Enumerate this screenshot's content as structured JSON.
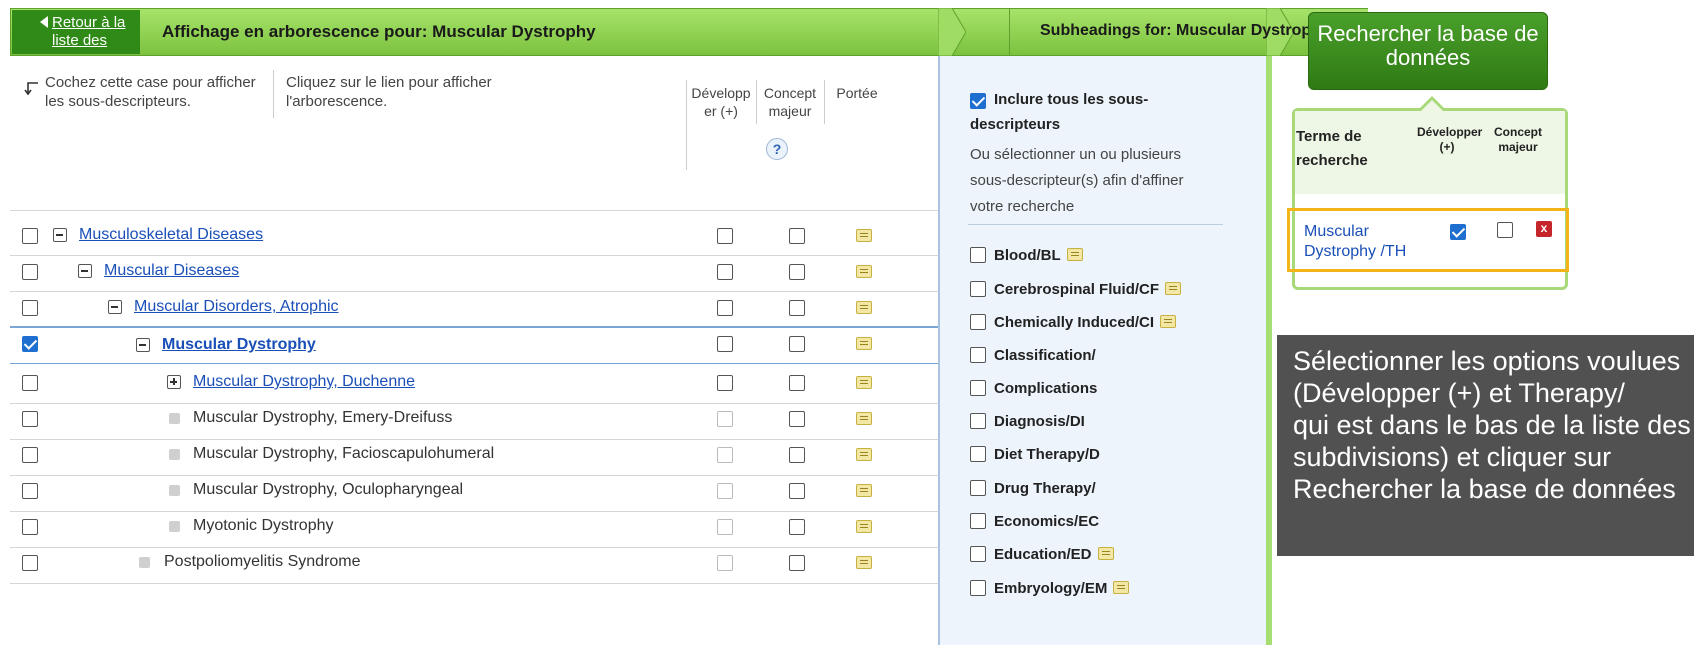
{
  "header": {
    "back_label": "Retour à la liste des",
    "tree_title": "Affichage en arborescence pour: Muscular Dystrophy",
    "subheadings_title": "Subheadings for: Muscular Dystrophy"
  },
  "tree": {
    "note_checkbox": "Cochez cette case pour afficher les sous-descripteurs.",
    "note_link": "Cliquez sur le lien pour afficher l'arborescence.",
    "col_explode": "Développ er (+)",
    "col_major": "Concept majeur",
    "col_scope": "Portée",
    "help_label": "?",
    "rows": [
      {
        "label": "Musculoskeletal Diseases",
        "link": true
      },
      {
        "label": "Muscular Diseases",
        "link": true
      },
      {
        "label": "Muscular Disorders, Atrophic",
        "link": true
      },
      {
        "label": "Muscular Dystrophy",
        "link": true,
        "selected": true
      },
      {
        "label": "Muscular Dystrophy, Duchenne",
        "link": true
      },
      {
        "label": "Muscular Dystrophy, Emery-Dreifuss",
        "link": false
      },
      {
        "label": "Muscular Dystrophy, Facioscapulohumeral",
        "link": false
      },
      {
        "label": "Muscular Dystrophy, Oculopharyngeal",
        "link": false
      },
      {
        "label": "Myotonic Dystrophy",
        "link": false
      },
      {
        "label": "Postpoliomyelitis Syndrome",
        "link": false
      }
    ]
  },
  "subheadings": {
    "include_all_label": "Inclure tous les sous-descripteurs",
    "include_all_line1": "Inclure tous les sous-",
    "include_all_line2": "descripteurs",
    "hint_line1": "Ou sélectionner un ou plusieurs",
    "hint_line2": "sous-descripteur(s) afin d'affiner",
    "hint_line3": "votre recherche",
    "items": [
      "Blood/BL",
      "Cerebrospinal Fluid/CF",
      "Chemically Induced/CI",
      "Classification/",
      "Complications",
      "Diagnosis/DI",
      "Diet Therapy/D",
      "Drug Therapy/",
      "Economics/EC",
      "Education/ED",
      "Embryology/EM"
    ]
  },
  "search": {
    "button_label": "Rechercher la base de données",
    "col_term": "Terme de recherche",
    "col_explode": "Développer (+)",
    "col_major": "Concept majeur",
    "term_line1": "Muscular",
    "term_line2": "Dystrophy /TH",
    "delete_label": "x"
  },
  "overlay": {
    "line1": "Sélectionner les options voulues",
    "line2": "(Développer (+) et Therapy/",
    "line3": "qui est dans le bas de la liste des",
    "line4": "subdivisions) et cliquer sur",
    "line5": "Rechercher la base de données"
  }
}
